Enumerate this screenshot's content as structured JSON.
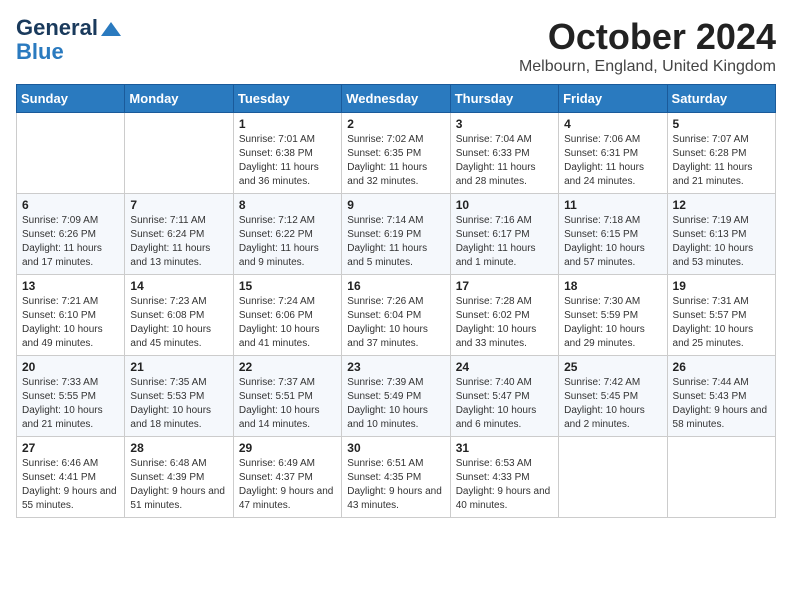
{
  "logo": {
    "line1": "General",
    "line2": "Blue"
  },
  "title": "October 2024",
  "subtitle": "Melbourn, England, United Kingdom",
  "weekdays": [
    "Sunday",
    "Monday",
    "Tuesday",
    "Wednesday",
    "Thursday",
    "Friday",
    "Saturday"
  ],
  "weeks": [
    [
      {
        "day": "",
        "sunrise": "",
        "sunset": "",
        "daylight": ""
      },
      {
        "day": "",
        "sunrise": "",
        "sunset": "",
        "daylight": ""
      },
      {
        "day": "1",
        "sunrise": "Sunrise: 7:01 AM",
        "sunset": "Sunset: 6:38 PM",
        "daylight": "Daylight: 11 hours and 36 minutes."
      },
      {
        "day": "2",
        "sunrise": "Sunrise: 7:02 AM",
        "sunset": "Sunset: 6:35 PM",
        "daylight": "Daylight: 11 hours and 32 minutes."
      },
      {
        "day": "3",
        "sunrise": "Sunrise: 7:04 AM",
        "sunset": "Sunset: 6:33 PM",
        "daylight": "Daylight: 11 hours and 28 minutes."
      },
      {
        "day": "4",
        "sunrise": "Sunrise: 7:06 AM",
        "sunset": "Sunset: 6:31 PM",
        "daylight": "Daylight: 11 hours and 24 minutes."
      },
      {
        "day": "5",
        "sunrise": "Sunrise: 7:07 AM",
        "sunset": "Sunset: 6:28 PM",
        "daylight": "Daylight: 11 hours and 21 minutes."
      }
    ],
    [
      {
        "day": "6",
        "sunrise": "Sunrise: 7:09 AM",
        "sunset": "Sunset: 6:26 PM",
        "daylight": "Daylight: 11 hours and 17 minutes."
      },
      {
        "day": "7",
        "sunrise": "Sunrise: 7:11 AM",
        "sunset": "Sunset: 6:24 PM",
        "daylight": "Daylight: 11 hours and 13 minutes."
      },
      {
        "day": "8",
        "sunrise": "Sunrise: 7:12 AM",
        "sunset": "Sunset: 6:22 PM",
        "daylight": "Daylight: 11 hours and 9 minutes."
      },
      {
        "day": "9",
        "sunrise": "Sunrise: 7:14 AM",
        "sunset": "Sunset: 6:19 PM",
        "daylight": "Daylight: 11 hours and 5 minutes."
      },
      {
        "day": "10",
        "sunrise": "Sunrise: 7:16 AM",
        "sunset": "Sunset: 6:17 PM",
        "daylight": "Daylight: 11 hours and 1 minute."
      },
      {
        "day": "11",
        "sunrise": "Sunrise: 7:18 AM",
        "sunset": "Sunset: 6:15 PM",
        "daylight": "Daylight: 10 hours and 57 minutes."
      },
      {
        "day": "12",
        "sunrise": "Sunrise: 7:19 AM",
        "sunset": "Sunset: 6:13 PM",
        "daylight": "Daylight: 10 hours and 53 minutes."
      }
    ],
    [
      {
        "day": "13",
        "sunrise": "Sunrise: 7:21 AM",
        "sunset": "Sunset: 6:10 PM",
        "daylight": "Daylight: 10 hours and 49 minutes."
      },
      {
        "day": "14",
        "sunrise": "Sunrise: 7:23 AM",
        "sunset": "Sunset: 6:08 PM",
        "daylight": "Daylight: 10 hours and 45 minutes."
      },
      {
        "day": "15",
        "sunrise": "Sunrise: 7:24 AM",
        "sunset": "Sunset: 6:06 PM",
        "daylight": "Daylight: 10 hours and 41 minutes."
      },
      {
        "day": "16",
        "sunrise": "Sunrise: 7:26 AM",
        "sunset": "Sunset: 6:04 PM",
        "daylight": "Daylight: 10 hours and 37 minutes."
      },
      {
        "day": "17",
        "sunrise": "Sunrise: 7:28 AM",
        "sunset": "Sunset: 6:02 PM",
        "daylight": "Daylight: 10 hours and 33 minutes."
      },
      {
        "day": "18",
        "sunrise": "Sunrise: 7:30 AM",
        "sunset": "Sunset: 5:59 PM",
        "daylight": "Daylight: 10 hours and 29 minutes."
      },
      {
        "day": "19",
        "sunrise": "Sunrise: 7:31 AM",
        "sunset": "Sunset: 5:57 PM",
        "daylight": "Daylight: 10 hours and 25 minutes."
      }
    ],
    [
      {
        "day": "20",
        "sunrise": "Sunrise: 7:33 AM",
        "sunset": "Sunset: 5:55 PM",
        "daylight": "Daylight: 10 hours and 21 minutes."
      },
      {
        "day": "21",
        "sunrise": "Sunrise: 7:35 AM",
        "sunset": "Sunset: 5:53 PM",
        "daylight": "Daylight: 10 hours and 18 minutes."
      },
      {
        "day": "22",
        "sunrise": "Sunrise: 7:37 AM",
        "sunset": "Sunset: 5:51 PM",
        "daylight": "Daylight: 10 hours and 14 minutes."
      },
      {
        "day": "23",
        "sunrise": "Sunrise: 7:39 AM",
        "sunset": "Sunset: 5:49 PM",
        "daylight": "Daylight: 10 hours and 10 minutes."
      },
      {
        "day": "24",
        "sunrise": "Sunrise: 7:40 AM",
        "sunset": "Sunset: 5:47 PM",
        "daylight": "Daylight: 10 hours and 6 minutes."
      },
      {
        "day": "25",
        "sunrise": "Sunrise: 7:42 AM",
        "sunset": "Sunset: 5:45 PM",
        "daylight": "Daylight: 10 hours and 2 minutes."
      },
      {
        "day": "26",
        "sunrise": "Sunrise: 7:44 AM",
        "sunset": "Sunset: 5:43 PM",
        "daylight": "Daylight: 9 hours and 58 minutes."
      }
    ],
    [
      {
        "day": "27",
        "sunrise": "Sunrise: 6:46 AM",
        "sunset": "Sunset: 4:41 PM",
        "daylight": "Daylight: 9 hours and 55 minutes."
      },
      {
        "day": "28",
        "sunrise": "Sunrise: 6:48 AM",
        "sunset": "Sunset: 4:39 PM",
        "daylight": "Daylight: 9 hours and 51 minutes."
      },
      {
        "day": "29",
        "sunrise": "Sunrise: 6:49 AM",
        "sunset": "Sunset: 4:37 PM",
        "daylight": "Daylight: 9 hours and 47 minutes."
      },
      {
        "day": "30",
        "sunrise": "Sunrise: 6:51 AM",
        "sunset": "Sunset: 4:35 PM",
        "daylight": "Daylight: 9 hours and 43 minutes."
      },
      {
        "day": "31",
        "sunrise": "Sunrise: 6:53 AM",
        "sunset": "Sunset: 4:33 PM",
        "daylight": "Daylight: 9 hours and 40 minutes."
      },
      {
        "day": "",
        "sunrise": "",
        "sunset": "",
        "daylight": ""
      },
      {
        "day": "",
        "sunrise": "",
        "sunset": "",
        "daylight": ""
      }
    ]
  ]
}
